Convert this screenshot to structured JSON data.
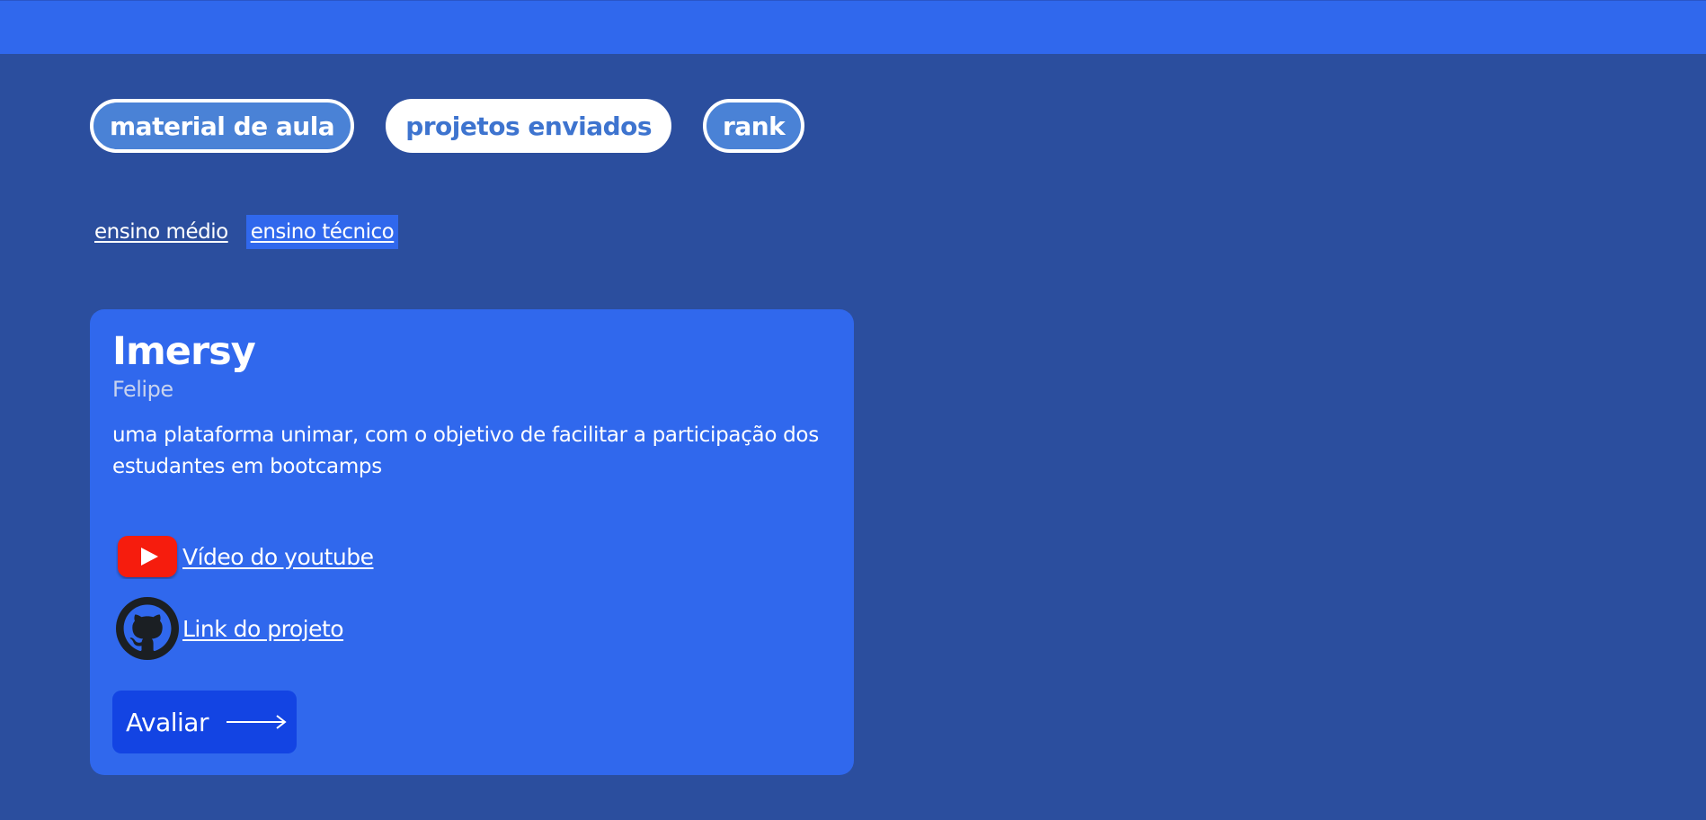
{
  "header": {
    "color": "#3068ed"
  },
  "tabs": [
    {
      "label": "material de aula",
      "active": false
    },
    {
      "label": "projetos enviados",
      "active": true
    },
    {
      "label": "rank",
      "active": false
    }
  ],
  "levels": [
    {
      "label": "ensino médio",
      "active": false
    },
    {
      "label": "ensino técnico",
      "active": true
    }
  ],
  "project": {
    "title": "Imersy",
    "author": "Felipe",
    "description": "uma plataforma unimar, com o objetivo de facilitar a participação dos estudantes em bootcamps",
    "youtube_label": "Vídeo do youtube",
    "youtube_icon": "youtube-icon",
    "github_label": "Link do projeto",
    "github_icon": "github-icon",
    "rate_label": "Avaliar",
    "rate_icon": "arrow-right-icon"
  },
  "colors": {
    "background": "#2b4e9e",
    "card": "#3068ed",
    "button": "#1344e3",
    "youtube_red": "#f61c0d"
  }
}
